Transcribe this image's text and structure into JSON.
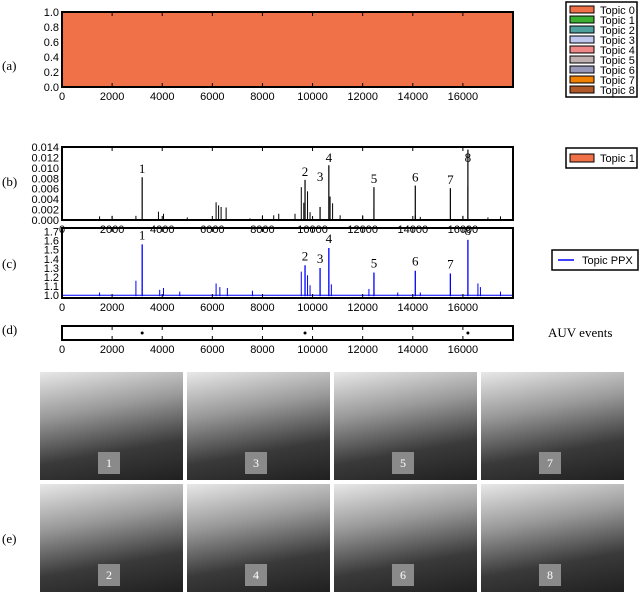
{
  "panel_labels": [
    "(a)",
    "(b)",
    "(c)",
    "(d)",
    "(e)"
  ],
  "chart_data": [
    {
      "type": "area",
      "panel": "(a)",
      "stacked": true,
      "xlim": [
        0,
        18000
      ],
      "ylim": [
        0,
        1.0
      ],
      "xticks": [
        0,
        2000,
        4000,
        6000,
        8000,
        10000,
        12000,
        14000,
        16000
      ],
      "yticks": [
        "0.0",
        "0.2",
        "0.4",
        "0.6",
        "0.8",
        "1.0"
      ],
      "legend": [
        {
          "name": "Topic 0",
          "color": "#f07048"
        },
        {
          "name": "Topic 1",
          "color": "#3cb030"
        },
        {
          "name": "Topic 2",
          "color": "#50a0a0"
        },
        {
          "name": "Topic 3",
          "color": "#c0c8f0"
        },
        {
          "name": "Topic 4",
          "color": "#f08888"
        },
        {
          "name": "Topic 5",
          "color": "#c0b0b0"
        },
        {
          "name": "Topic 6",
          "color": "#9898b8"
        },
        {
          "name": "Topic 7",
          "color": "#f08000"
        },
        {
          "name": "Topic 8",
          "color": "#b05828"
        }
      ],
      "legend_placement": "right",
      "note_values": "Topic 0 ≈ 1.0 throughout"
    },
    {
      "type": "bar",
      "panel": "(b)",
      "xlim": [
        0,
        18000
      ],
      "ylim": [
        0,
        0.014
      ],
      "xticks": [
        0,
        2000,
        4000,
        6000,
        8000,
        10000,
        12000,
        14000,
        16000
      ],
      "yticks": [
        "0.000",
        "0.002",
        "0.004",
        "0.006",
        "0.008",
        "0.010",
        "0.012",
        "0.014"
      ],
      "legend": [
        {
          "name": "Topic 1",
          "color": "#f07048"
        }
      ],
      "peaks": [
        {
          "label": "1",
          "x": 3200,
          "y": 0.0082
        },
        {
          "label": "2",
          "x": 9700,
          "y": 0.0077
        },
        {
          "label": "3",
          "x": 10300,
          "y": 0.0025
        },
        {
          "label": "4",
          "x": 10650,
          "y": 0.0105
        },
        {
          "label": "5",
          "x": 12450,
          "y": 0.0063
        },
        {
          "label": "6",
          "x": 14100,
          "y": 0.0066
        },
        {
          "label": "7",
          "x": 15500,
          "y": 0.0061
        },
        {
          "label": "8",
          "x": 16200,
          "y": 0.0135
        }
      ],
      "minor": [
        [
          1500,
          0.0007
        ],
        [
          2000,
          0.0008
        ],
        [
          2950,
          0.0008
        ],
        [
          3850,
          0.0016
        ],
        [
          4050,
          0.0012
        ],
        [
          5000,
          0.0005
        ],
        [
          6150,
          0.0034
        ],
        [
          6250,
          0.0028
        ],
        [
          6350,
          0.0025
        ],
        [
          6550,
          0.0024
        ],
        [
          7500,
          0.0003
        ],
        [
          8000,
          0.0009
        ],
        [
          8450,
          0.0009
        ],
        [
          8650,
          0.0012
        ],
        [
          9300,
          0.0012
        ],
        [
          9550,
          0.0063
        ],
        [
          9650,
          0.0033
        ],
        [
          9800,
          0.0055
        ],
        [
          9900,
          0.0015
        ],
        [
          10700,
          0.0045
        ],
        [
          10800,
          0.0032
        ],
        [
          11100,
          0.0009
        ],
        [
          12000,
          0.0009
        ],
        [
          12450,
          0.0024
        ],
        [
          14100,
          0.0009
        ],
        [
          14300,
          0.0006
        ],
        [
          16000,
          0.0008
        ],
        [
          16200,
          0.0065
        ],
        [
          17000,
          0.0005
        ],
        [
          17500,
          0.0007
        ]
      ]
    },
    {
      "type": "line",
      "panel": "(c)",
      "xlim": [
        0,
        18000
      ],
      "ylim": [
        0.98,
        1.75
      ],
      "xticks": [
        0,
        2000,
        4000,
        6000,
        8000,
        10000,
        12000,
        14000,
        16000
      ],
      "yticks": [
        "1.0",
        "1.1",
        "1.2",
        "1.3",
        "1.4",
        "1.5",
        "1.6",
        "1.7"
      ],
      "legend": [
        {
          "name": "Topic PPX",
          "color": "#0000ff"
        }
      ],
      "peaks": [
        {
          "label": "1",
          "x": 3200,
          "y": 1.57
        },
        {
          "label": "2",
          "x": 9700,
          "y": 1.34
        },
        {
          "label": "3",
          "x": 10300,
          "y": 1.31
        },
        {
          "label": "4",
          "x": 10650,
          "y": 1.53
        },
        {
          "label": "5",
          "x": 12450,
          "y": 1.26
        },
        {
          "label": "6",
          "x": 14100,
          "y": 1.28
        },
        {
          "label": "7",
          "x": 15500,
          "y": 1.25
        },
        {
          "label": "8",
          "x": 16200,
          "y": 1.62
        }
      ],
      "minor": [
        [
          1500,
          1.04
        ],
        [
          2950,
          1.17
        ],
        [
          3900,
          1.07
        ],
        [
          4050,
          1.09
        ],
        [
          4700,
          1.05
        ],
        [
          6150,
          1.14
        ],
        [
          6300,
          1.1
        ],
        [
          6600,
          1.09
        ],
        [
          7600,
          1.06
        ],
        [
          9550,
          1.27
        ],
        [
          9800,
          1.23
        ],
        [
          9900,
          1.12
        ],
        [
          10750,
          1.13
        ],
        [
          12250,
          1.08
        ],
        [
          13400,
          1.04
        ],
        [
          14300,
          1.04
        ],
        [
          16600,
          1.14
        ],
        [
          16700,
          1.1
        ],
        [
          17500,
          1.05
        ]
      ]
    },
    {
      "type": "scatter",
      "panel": "(d)",
      "legend_text": "AUV events",
      "xlim": [
        0,
        18000
      ],
      "xticks": [
        0,
        2000,
        4000,
        6000,
        8000,
        10000,
        12000,
        14000,
        16000
      ],
      "events": [
        3200,
        9700,
        16200
      ]
    }
  ],
  "photos": {
    "row1": [
      "1",
      "3",
      "5",
      "7"
    ],
    "row2": [
      "2",
      "4",
      "6",
      "8"
    ]
  }
}
